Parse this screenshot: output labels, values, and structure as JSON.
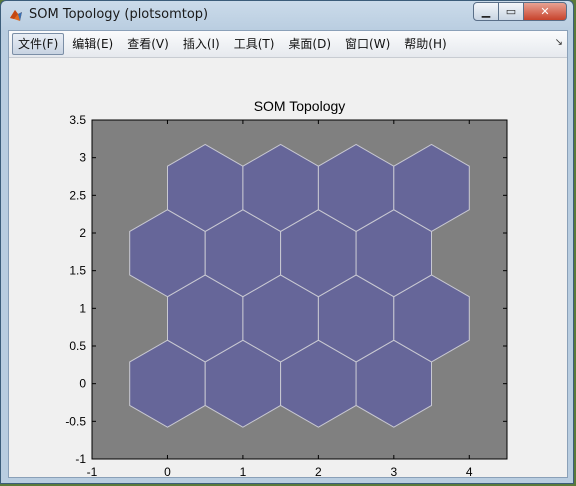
{
  "window": {
    "title": "SOM Topology (plotsomtop)",
    "controls": {
      "minimize": "▁",
      "maximize": "▭",
      "close": "✕"
    }
  },
  "menubar": {
    "items": [
      {
        "label": "文件(F)",
        "active": true
      },
      {
        "label": "编辑(E)"
      },
      {
        "label": "查看(V)"
      },
      {
        "label": "插入(I)"
      },
      {
        "label": "工具(T)"
      },
      {
        "label": "桌面(D)"
      },
      {
        "label": "窗口(W)"
      },
      {
        "label": "帮助(H)"
      }
    ],
    "overflow_icon": "chevron-double-icon"
  },
  "colors": {
    "axes_background": "#808080",
    "hex_fill": "#666699",
    "hex_edge": "#c8c8d2",
    "figure_background": "#f0f0f0"
  },
  "chart_data": {
    "type": "scatter",
    "title": "SOM Topology",
    "xlabel": "",
    "ylabel": "",
    "xlim": [
      -1,
      4.5
    ],
    "ylim": [
      -1,
      3.5
    ],
    "xticks": [
      "-1",
      "0",
      "1",
      "2",
      "3",
      "4"
    ],
    "yticks": [
      "-1",
      "-0.5",
      "0",
      "0.5",
      "1",
      "1.5",
      "2",
      "2.5",
      "3",
      "3.5"
    ],
    "grid": false,
    "topology": "hexagonal",
    "grid_size": [
      4,
      4
    ],
    "neurons": [
      {
        "x": 0,
        "y": 0
      },
      {
        "x": 1,
        "y": 0
      },
      {
        "x": 2,
        "y": 0
      },
      {
        "x": 3,
        "y": 0
      },
      {
        "x": 0.5,
        "y": 0.866
      },
      {
        "x": 1.5,
        "y": 0.866
      },
      {
        "x": 2.5,
        "y": 0.866
      },
      {
        "x": 3.5,
        "y": 0.866
      },
      {
        "x": 0,
        "y": 1.732
      },
      {
        "x": 1,
        "y": 1.732
      },
      {
        "x": 2,
        "y": 1.732
      },
      {
        "x": 3,
        "y": 1.732
      },
      {
        "x": 0.5,
        "y": 2.598
      },
      {
        "x": 1.5,
        "y": 2.598
      },
      {
        "x": 2.5,
        "y": 2.598
      },
      {
        "x": 3.5,
        "y": 2.598
      }
    ]
  }
}
